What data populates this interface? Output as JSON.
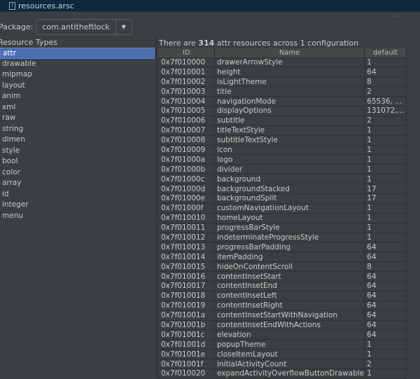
{
  "tab": {
    "title": "resources.arsc",
    "icon": "file-icon"
  },
  "package": {
    "label": "Package:",
    "value": "com.antitheftlock"
  },
  "resource_types": {
    "header": "Resource Types",
    "selected": "attr",
    "items": [
      "attr",
      "drawable",
      "mipmap",
      "layout",
      "anim",
      "xml",
      "raw",
      "string",
      "dimen",
      "style",
      "bool",
      "color",
      "array",
      "id",
      "integer",
      "menu"
    ]
  },
  "summary": {
    "prefix": "There are ",
    "count": "314",
    "suffix": " attr resources across 1 configuration"
  },
  "table": {
    "columns": [
      "ID",
      "Name",
      "default"
    ],
    "rows": [
      [
        "0x7f010000",
        "drawerArrowStyle",
        "1"
      ],
      [
        "0x7f010001",
        "height",
        "64"
      ],
      [
        "0x7f010002",
        "isLightTheme",
        "8"
      ],
      [
        "0x7f010003",
        "title",
        "2"
      ],
      [
        "0x7f010004",
        "navigationMode",
        "65536, ..."
      ],
      [
        "0x7f010005",
        "displayOptions",
        "131072,..."
      ],
      [
        "0x7f010006",
        "subtitle",
        "2"
      ],
      [
        "0x7f010007",
        "titleTextStyle",
        "1"
      ],
      [
        "0x7f010008",
        "subtitleTextStyle",
        "1"
      ],
      [
        "0x7f010009",
        "icon",
        "1"
      ],
      [
        "0x7f01000a",
        "logo",
        "1"
      ],
      [
        "0x7f01000b",
        "divider",
        "1"
      ],
      [
        "0x7f01000c",
        "background",
        "1"
      ],
      [
        "0x7f01000d",
        "backgroundStacked",
        "17"
      ],
      [
        "0x7f01000e",
        "backgroundSplit",
        "17"
      ],
      [
        "0x7f01000f",
        "customNavigationLayout",
        "1"
      ],
      [
        "0x7f010010",
        "homeLayout",
        "1"
      ],
      [
        "0x7f010011",
        "progressBarStyle",
        "1"
      ],
      [
        "0x7f010012",
        "indeterminateProgressStyle",
        "1"
      ],
      [
        "0x7f010013",
        "progressBarPadding",
        "64"
      ],
      [
        "0x7f010014",
        "itemPadding",
        "64"
      ],
      [
        "0x7f010015",
        "hideOnContentScroll",
        "8"
      ],
      [
        "0x7f010016",
        "contentInsetStart",
        "64"
      ],
      [
        "0x7f010017",
        "contentInsetEnd",
        "64"
      ],
      [
        "0x7f010018",
        "contentInsetLeft",
        "64"
      ],
      [
        "0x7f010019",
        "contentInsetRight",
        "64"
      ],
      [
        "0x7f01001a",
        "contentInsetStartWithNavigation",
        "64"
      ],
      [
        "0x7f01001b",
        "contentInsetEndWithActions",
        "64"
      ],
      [
        "0x7f01001c",
        "elevation",
        "64"
      ],
      [
        "0x7f01001d",
        "popupTheme",
        "1"
      ],
      [
        "0x7f01001e",
        "closeItemLayout",
        "1"
      ],
      [
        "0x7f01001f",
        "initialActivityCount",
        "2"
      ],
      [
        "0x7f010020",
        "expandActivityOverflowButtonDrawable",
        "1"
      ]
    ]
  }
}
